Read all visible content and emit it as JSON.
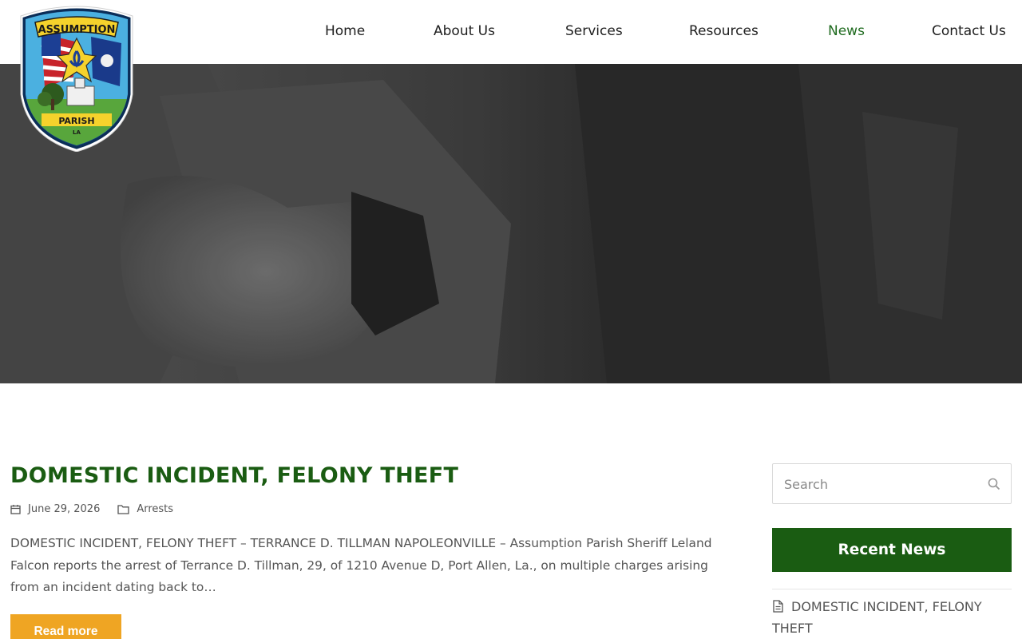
{
  "brand": {
    "logo_top_text": "ASSUMPTION",
    "logo_bottom_text": "PARISH",
    "logo_state_text": "LA"
  },
  "nav": {
    "items": [
      {
        "label": "Home",
        "active": false
      },
      {
        "label": "About Us",
        "active": false
      },
      {
        "label": "Services",
        "active": false
      },
      {
        "label": "Resources",
        "active": false
      },
      {
        "label": "News",
        "active": true
      },
      {
        "label": "Contact Us",
        "active": false
      }
    ]
  },
  "post": {
    "title": "DOMESTIC INCIDENT, FELONY THEFT",
    "date": "June 29, 2026",
    "category": "Arrests",
    "excerpt": "DOMESTIC INCIDENT, FELONY THEFT – TERRANCE D. TILLMAN NAPOLEONVILLE – Assumption Parish Sheriff Leland Falcon reports the arrest of Terrance D. Tillman, 29, of 1210 Avenue D, Port Allen, La., on multiple charges arising from an incident dating back to…",
    "read_more_label": "Read more"
  },
  "sidebar": {
    "search_placeholder": "Search",
    "recent_title": "Recent News",
    "recent_items": [
      {
        "label": "DOMESTIC INCIDENT, FELONY THEFT"
      }
    ]
  },
  "colors": {
    "brand_green": "#1a5c12",
    "active_nav": "#1f6b1f",
    "accent_orange": "#efa523",
    "hero_gray": "#3b3b3b"
  },
  "icons": {
    "calendar": "calendar-icon",
    "folder": "folder-icon",
    "search": "search-icon",
    "document": "document-icon"
  }
}
